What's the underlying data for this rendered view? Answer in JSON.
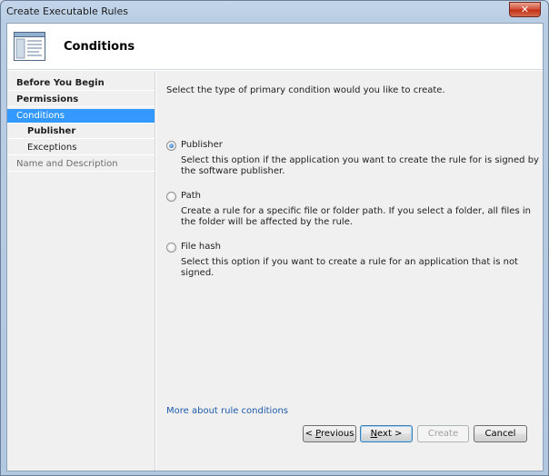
{
  "window": {
    "title": "Create Executable Rules",
    "close_glyph": "✕"
  },
  "header": {
    "title": "Conditions",
    "icon": "dialog-icon"
  },
  "nav": {
    "items": [
      {
        "label": "Before You Begin",
        "state": "bold"
      },
      {
        "label": "Permissions",
        "state": "bold"
      },
      {
        "label": "Conditions",
        "state": "selected"
      },
      {
        "label": "Publisher",
        "state": "bold-sub"
      },
      {
        "label": "Exceptions",
        "state": "sub"
      },
      {
        "label": "Name and Description",
        "state": "dim"
      }
    ]
  },
  "content": {
    "prompt": "Select the type of primary condition would you like to create.",
    "options": [
      {
        "label": "Publisher",
        "checked": true,
        "description": "Select this option if the application you want to create the rule for is signed by the software publisher."
      },
      {
        "label": "Path",
        "checked": false,
        "description": "Create a rule for a specific file or folder path. If you select a folder, all files in the folder will be affected by the rule."
      },
      {
        "label": "File hash",
        "checked": false,
        "description": "Select this option if you want to create a rule for an application that is not signed."
      }
    ],
    "more_link": "More about rule conditions"
  },
  "buttons": {
    "previous_prefix": "< ",
    "previous_accel": "P",
    "previous_rest": "revious",
    "next_accel": "N",
    "next_rest": "ext >",
    "create": "Create",
    "cancel": "Cancel"
  }
}
